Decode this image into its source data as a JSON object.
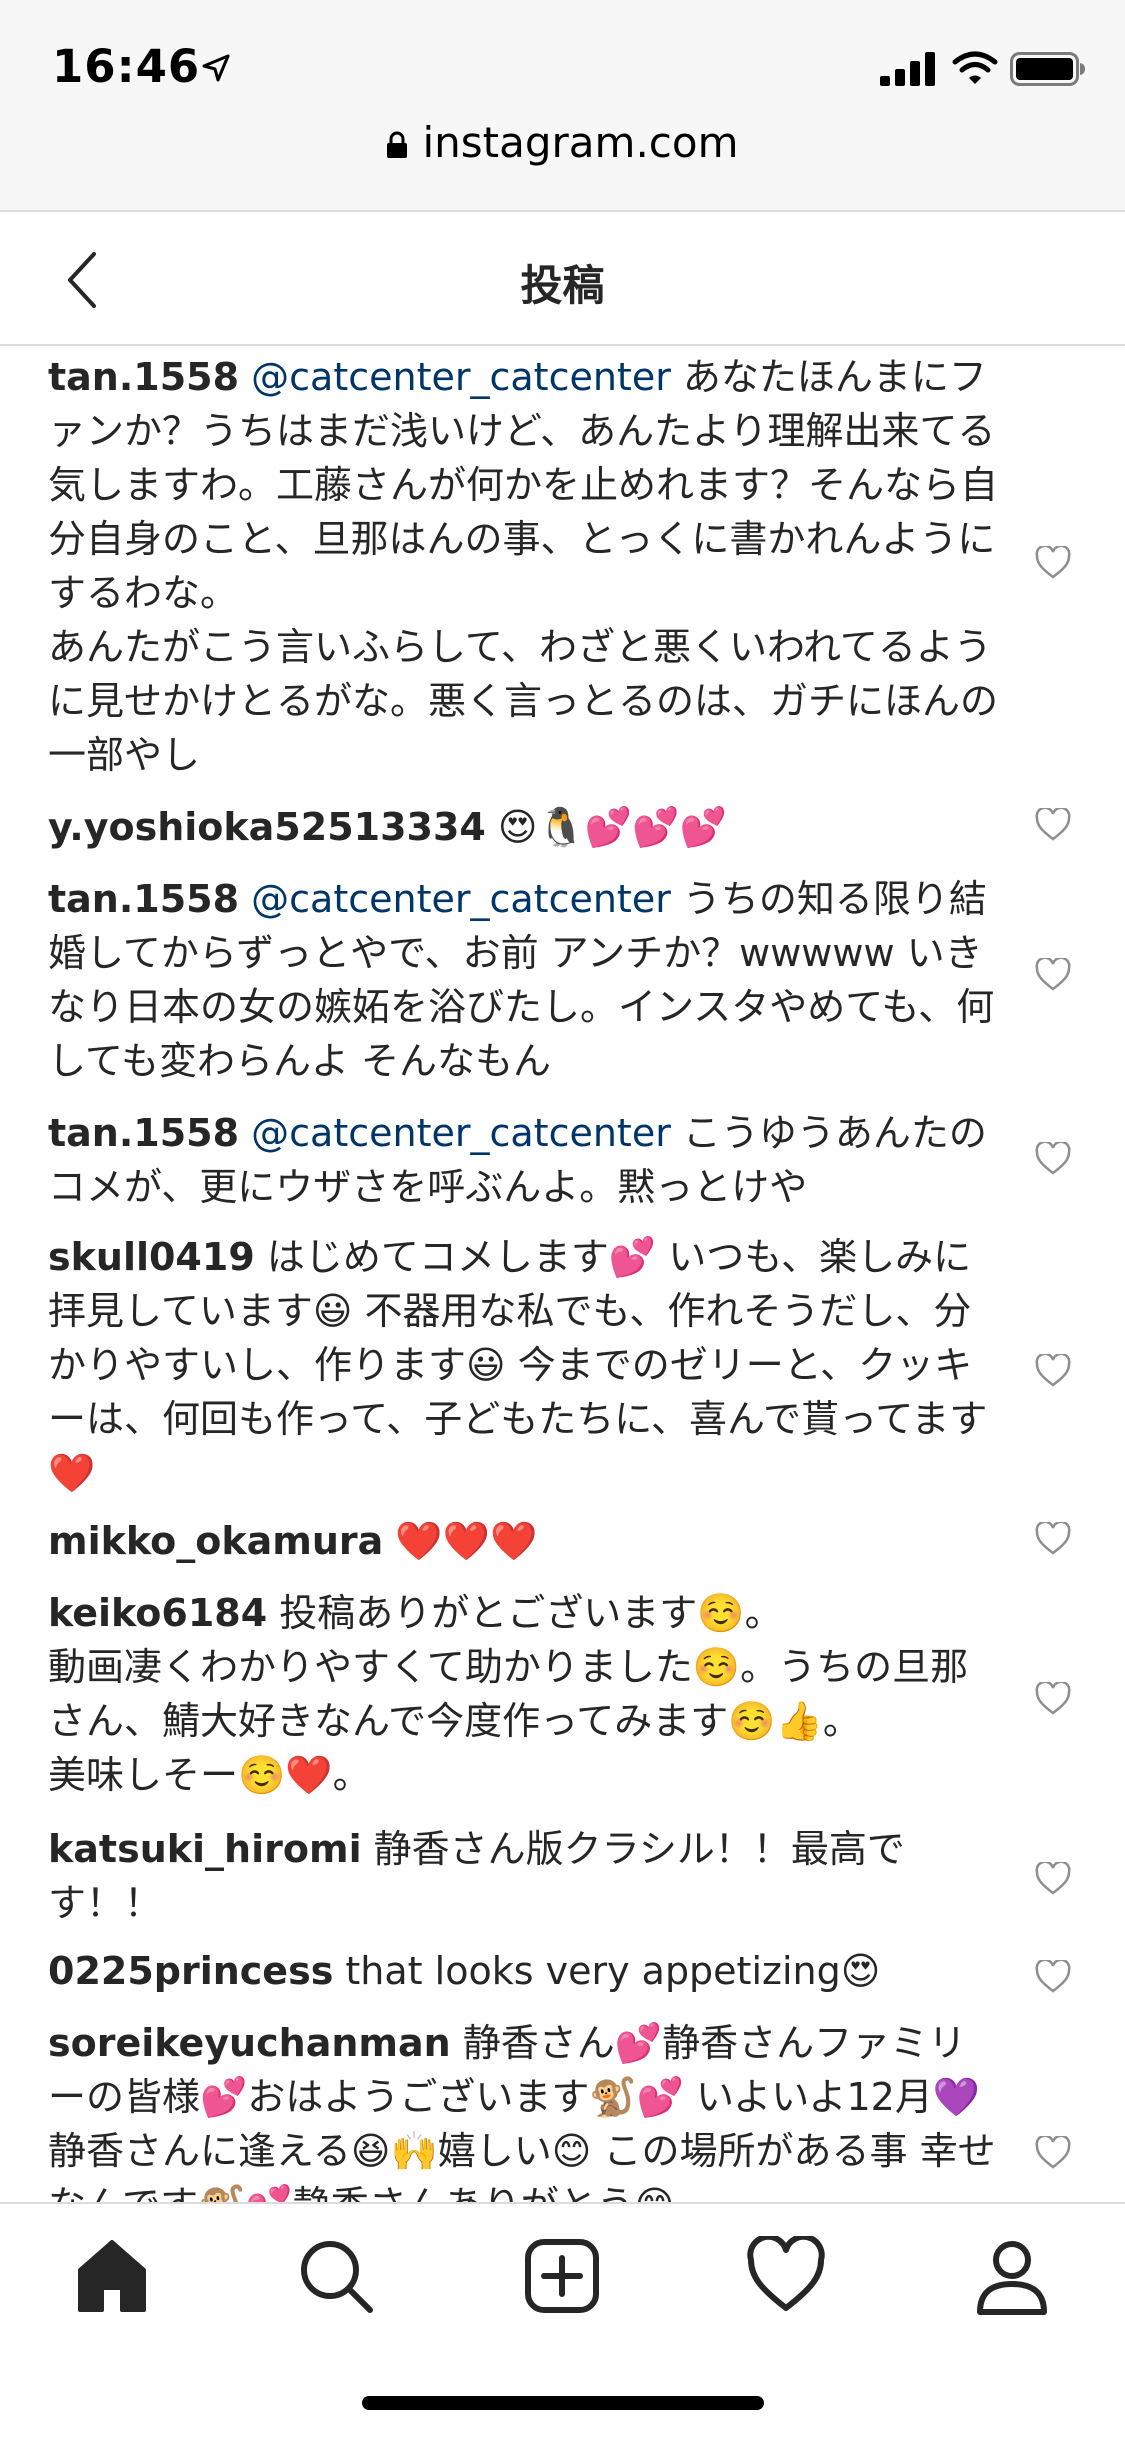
{
  "status_bar": {
    "time": "16:46"
  },
  "browser": {
    "url": "instagram.com"
  },
  "header": {
    "title": "投稿"
  },
  "comments": [
    {
      "username": "tan.1558",
      "mention": "@catcenter_catcenter",
      "text": " あなたほんまにファンか？うちはまだ浅いけど、あんたより理解出来てる気しますわ。工藤さんが何かを止めれます？そんなら自分自身のこと、旦那はんの事、とっくに書かれんようにするわな。\nあんたがこう言いふらして、わざと悪くいわれてるように見せかけとるがな。悪く言っとるのは、ガチにほんの一部やし"
    },
    {
      "username": "y.yoshioka52513334",
      "mention": "",
      "text": " 😍🐧💕💕💕"
    },
    {
      "username": "tan.1558",
      "mention": "@catcenter_catcenter",
      "text": " うちの知る限り結婚してからずっとやで、お前 アンチか？wwwww いきなり日本の女の嫉妬を浴びたし。インスタやめても、何しても変わらんよ そんなもん"
    },
    {
      "username": "tan.1558",
      "mention": "@catcenter_catcenter",
      "text": " こうゆうあんたのコメが、更にウザさを呼ぶんよ。黙っとけや"
    },
    {
      "username": "skull0419",
      "mention": "",
      "text": " はじめてコメします💕 いつも、楽しみに拝見しています😃 不器用な私でも、作れそうだし、分かりやすいし、作ります😃 今までのゼリーと、クッキーは、何回も作って、子どもたちに、喜んで貰ってます❤️"
    },
    {
      "username": "mikko_okamura",
      "mention": "",
      "text": " ❤️❤️❤️"
    },
    {
      "username": "keiko6184",
      "mention": "",
      "text": " 投稿ありがとございます☺️。\n動画凄くわかりやすくて助かりました☺️。うちの旦那さん、鯖大好きなんで今度作ってみます☺️👍。\n美味しそー☺️❤️。"
    },
    {
      "username": "katsuki_hiromi",
      "mention": "",
      "text": " 静香さん版クラシル！！最高です！！"
    },
    {
      "username": "0225princess",
      "mention": "",
      "text": " that looks very appetizing😍"
    },
    {
      "username": "soreikeyuchanman",
      "mention": "",
      "text": " 静香さん💕静香さんファミリーの皆様💕おはようございます🐒💕 いよいよ12月💜静香さんに逢える😆🙌嬉しい😊 この場所がある事 幸せなんです🐒💕静香さんありがとう😊"
    }
  ]
}
